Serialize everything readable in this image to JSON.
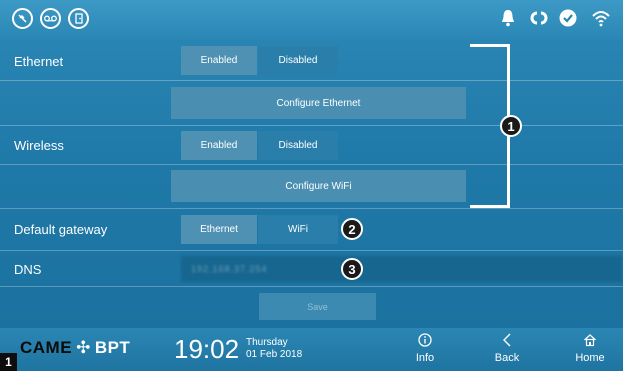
{
  "statusbar": {
    "left_icons": [
      "mute-icon",
      "answering-machine-icon",
      "door-open-icon"
    ],
    "right_icons": [
      "bell-icon",
      "link-icon",
      "check-icon",
      "wifi-icon"
    ]
  },
  "ethernet": {
    "label": "Ethernet",
    "enabled": "Enabled",
    "disabled": "Disabled",
    "configure": "Configure Ethernet"
  },
  "wireless": {
    "label": "Wireless",
    "enabled": "Enabled",
    "disabled": "Disabled",
    "configure": "Configure WiFi"
  },
  "gateway": {
    "label": "Default gateway",
    "ethernet": "Ethernet",
    "wifi": "WiFi"
  },
  "dns": {
    "label": "DNS",
    "value": "192.168.37.254"
  },
  "save_label": "Save",
  "callouts": [
    "1",
    "2",
    "3"
  ],
  "bottombar": {
    "brand_came": "CAME",
    "brand_bpt": "BPT",
    "time": "19:02",
    "weekday": "Thursday",
    "date": "01 Feb 2018",
    "info": "Info",
    "back": "Back",
    "home": "Home"
  },
  "figure_number": "1",
  "colors": {
    "accent": "#2a86b4",
    "segment_active": "#4f91b3",
    "segment_inactive": "#2a7eaa",
    "callout_bg": "#1a1a1a"
  }
}
